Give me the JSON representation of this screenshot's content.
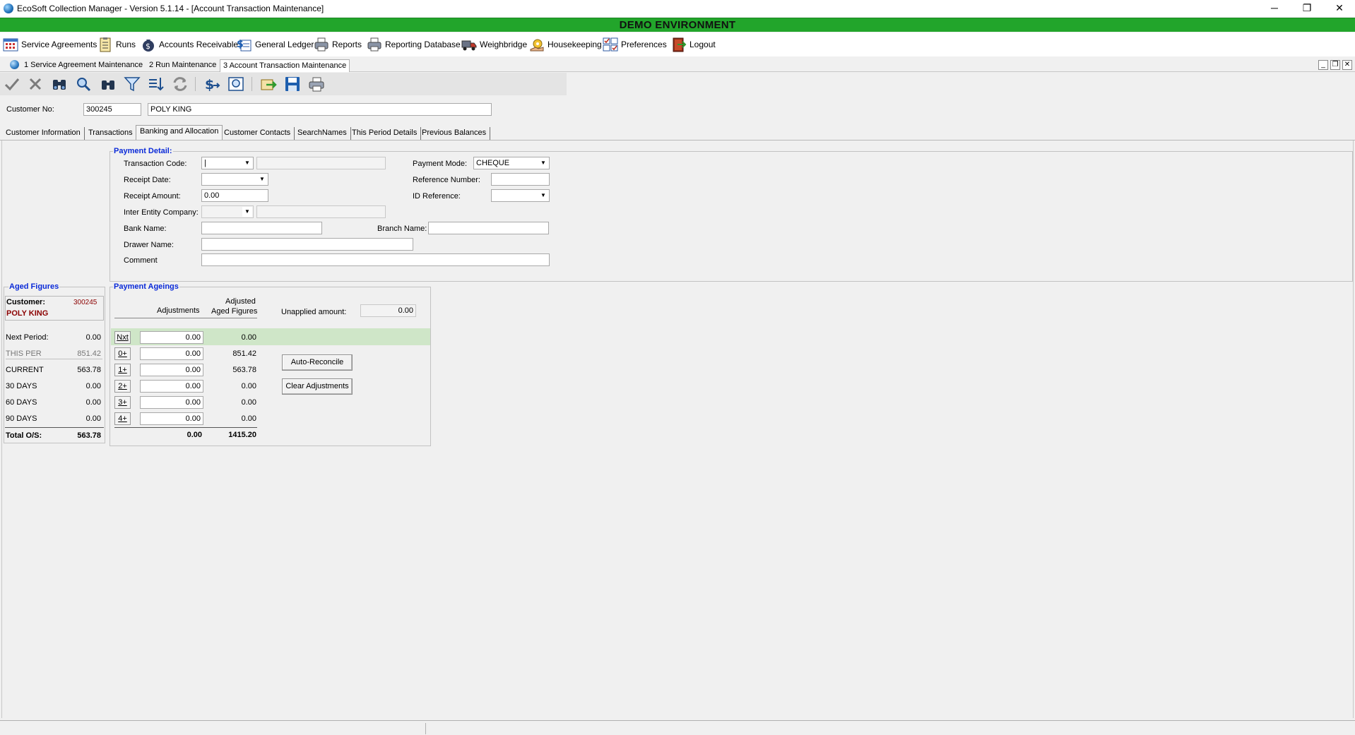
{
  "window": {
    "title": "EcoSoft Collection Manager - Version 5.1.14 - [Account Transaction Maintenance]",
    "minimize": "─",
    "restore": "❐",
    "close": "✕"
  },
  "banner": "DEMO ENVIRONMENT",
  "main_menu": [
    {
      "label": "Service Agreements",
      "icon": "calendar-grid-icon"
    },
    {
      "label": "Runs",
      "icon": "clipboard-icon"
    },
    {
      "label": "Accounts Receivable",
      "icon": "money-bag-icon"
    },
    {
      "label": "General Ledger",
      "icon": "ledger-dollar-icon"
    },
    {
      "label": "Reports",
      "icon": "printer-icon"
    },
    {
      "label": "Reporting Database",
      "icon": "printer-database-icon"
    },
    {
      "label": "Weighbridge",
      "icon": "truck-icon"
    },
    {
      "label": "Housekeeping",
      "icon": "gear-hand-icon"
    },
    {
      "label": "Preferences",
      "icon": "checklist-icon"
    },
    {
      "label": "Logout",
      "icon": "exit-door-icon"
    }
  ],
  "doc_tabs": [
    {
      "label": "1 Service Agreement Maintenance",
      "active": false
    },
    {
      "label": "2 Run Maintenance",
      "active": false
    },
    {
      "label": "3 Account Transaction Maintenance",
      "active": true
    }
  ],
  "customer": {
    "label": "Customer No:",
    "number": "300245",
    "name": "POLY KING"
  },
  "tabs": [
    {
      "label": "Customer Information",
      "active": false
    },
    {
      "label": "Transactions",
      "active": false
    },
    {
      "label": "Banking and Allocation",
      "active": true
    },
    {
      "label": "Customer Contacts",
      "active": false
    },
    {
      "label": "SearchNames",
      "active": false
    },
    {
      "label": "This Period Details",
      "active": false
    },
    {
      "label": "Previous Balances",
      "active": false
    }
  ],
  "payment_detail": {
    "title": "Payment Detail:",
    "transaction_code_label": "Transaction Code:",
    "transaction_code": "|",
    "transaction_desc": "",
    "receipt_date_label": "Receipt Date:",
    "receipt_date": "",
    "receipt_amount_label": "Receipt Amount:",
    "receipt_amount": "0.00",
    "inter_entity_label": "Inter Entity Company:",
    "inter_entity": "",
    "inter_entity_desc": "",
    "bank_name_label": "Bank Name:",
    "bank_name": "",
    "branch_name_label": "Branch Name:",
    "branch_name": "",
    "drawer_name_label": "Drawer Name:",
    "drawer_name": "",
    "comment_label": "Comment",
    "comment": "",
    "payment_mode_label": "Payment Mode:",
    "payment_mode": "CHEQUE",
    "reference_number_label": "Reference Number:",
    "reference_number": "",
    "id_reference_label": "ID Reference:",
    "id_reference": ""
  },
  "aged_figures": {
    "title": "Aged Figures",
    "customer_label": "Customer:",
    "customer_no": "300245",
    "customer_name": "POLY KING",
    "rows": [
      {
        "label": "Next Period:",
        "value": "0.00"
      },
      {
        "label": "THIS PER",
        "value": "851.42"
      },
      {
        "label": "CURRENT",
        "value": "563.78"
      },
      {
        "label": "30 DAYS",
        "value": "0.00"
      },
      {
        "label": "60 DAYS",
        "value": "0.00"
      },
      {
        "label": "90 DAYS",
        "value": "0.00"
      }
    ],
    "total_label": "Total O/S:",
    "total_value": "563.78"
  },
  "payment_ageings": {
    "title": "Payment Ageings",
    "adjustments_header": "Adjustments",
    "adjusted_header_1": "Adjusted",
    "adjusted_header_2": "Aged Figures",
    "unapplied_label": "Unapplied amount:",
    "unapplied_amount": "0.00",
    "rows": [
      {
        "button": "Nxt",
        "adjustment": "0.00",
        "adjusted": "0.00"
      },
      {
        "button": "0+",
        "adjustment": "0.00",
        "adjusted": "851.42"
      },
      {
        "button": "1+",
        "adjustment": "0.00",
        "adjusted": "563.78"
      },
      {
        "button": "2+",
        "adjustment": "0.00",
        "adjusted": "0.00"
      },
      {
        "button": "3+",
        "adjustment": "0.00",
        "adjusted": "0.00"
      },
      {
        "button": "4+",
        "adjustment": "0.00",
        "adjusted": "0.00"
      }
    ],
    "total_adjustments": "0.00",
    "total_adjusted": "1415.20",
    "auto_reconcile_label": "Auto-Reconcile",
    "clear_adjustments_label": "Clear Adjustments"
  },
  "colors": {
    "banner": "#22a52b",
    "group_title": "#0a2ad8",
    "customer_red": "#8b0000",
    "highlight_row": "#cfe6c8"
  }
}
